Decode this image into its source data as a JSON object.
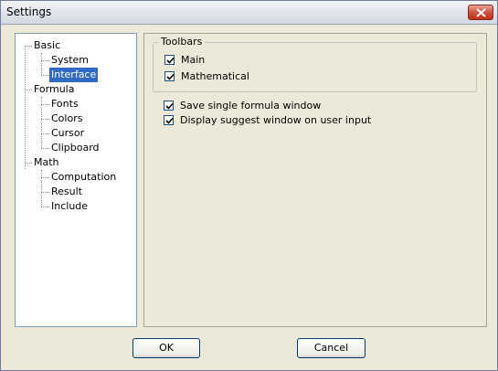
{
  "window": {
    "title": "Settings"
  },
  "tree": {
    "items": [
      {
        "label": "Basic"
      },
      {
        "label": "System"
      },
      {
        "label": "Interface",
        "selected": true
      },
      {
        "label": "Formula"
      },
      {
        "label": "Fonts"
      },
      {
        "label": "Colors"
      },
      {
        "label": "Cursor"
      },
      {
        "label": "Clipboard"
      },
      {
        "label": "Math"
      },
      {
        "label": "Computation"
      },
      {
        "label": "Result"
      },
      {
        "label": "Include"
      }
    ]
  },
  "toolbars": {
    "group_label": "Toolbars",
    "main_label": "Main",
    "main_checked": true,
    "math_label": "Mathematical",
    "math_checked": true
  },
  "options": {
    "single_window_label": "Save single formula window",
    "single_window_checked": true,
    "suggest_label": "Display suggest window on user input",
    "suggest_checked": true
  },
  "buttons": {
    "ok": "OK",
    "cancel": "Cancel"
  },
  "colors": {
    "selection": "#316ac5",
    "close": "#c2301c"
  }
}
